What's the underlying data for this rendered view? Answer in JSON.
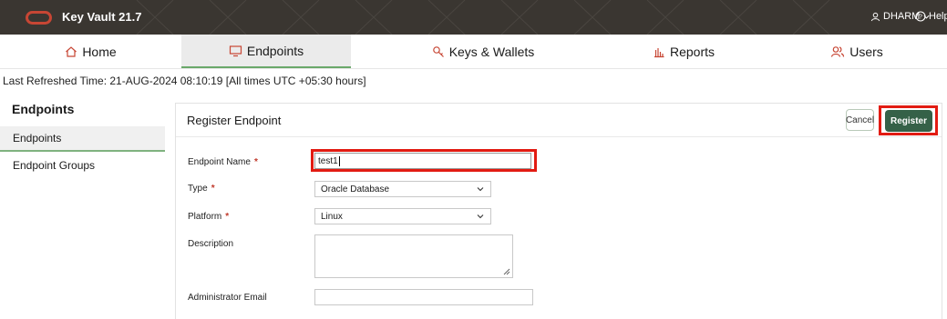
{
  "header": {
    "app_title": "Key Vault 21.7",
    "user_name": "DHARM",
    "help_label": "Help",
    "brand_color": "#c74634"
  },
  "nav": {
    "tabs": [
      {
        "label": "Home",
        "icon": "home-icon"
      },
      {
        "label": "Endpoints",
        "icon": "monitor-icon",
        "active": true
      },
      {
        "label": "Keys & Wallets",
        "icon": "key-icon"
      },
      {
        "label": "Reports",
        "icon": "bar-chart-icon"
      },
      {
        "label": "Users",
        "icon": "users-icon"
      }
    ]
  },
  "refresh_text": "Last Refreshed Time: 21-AUG-2024 08:10:19 [All times UTC +05:30 hours]",
  "sidebar": {
    "title": "Endpoints",
    "items": [
      {
        "label": "Endpoints",
        "active": true
      },
      {
        "label": "Endpoint Groups"
      }
    ]
  },
  "form": {
    "title": "Register Endpoint",
    "cancel_label": "Cancel",
    "register_label": "Register",
    "endpoint_name_label": "Endpoint Name",
    "endpoint_name_value": "test1",
    "type_label": "Type",
    "type_value": "Oracle Database",
    "platform_label": "Platform",
    "platform_value": "Linux",
    "description_label": "Description",
    "admin_email_label": "Administrator Email",
    "required_mark": "*"
  }
}
